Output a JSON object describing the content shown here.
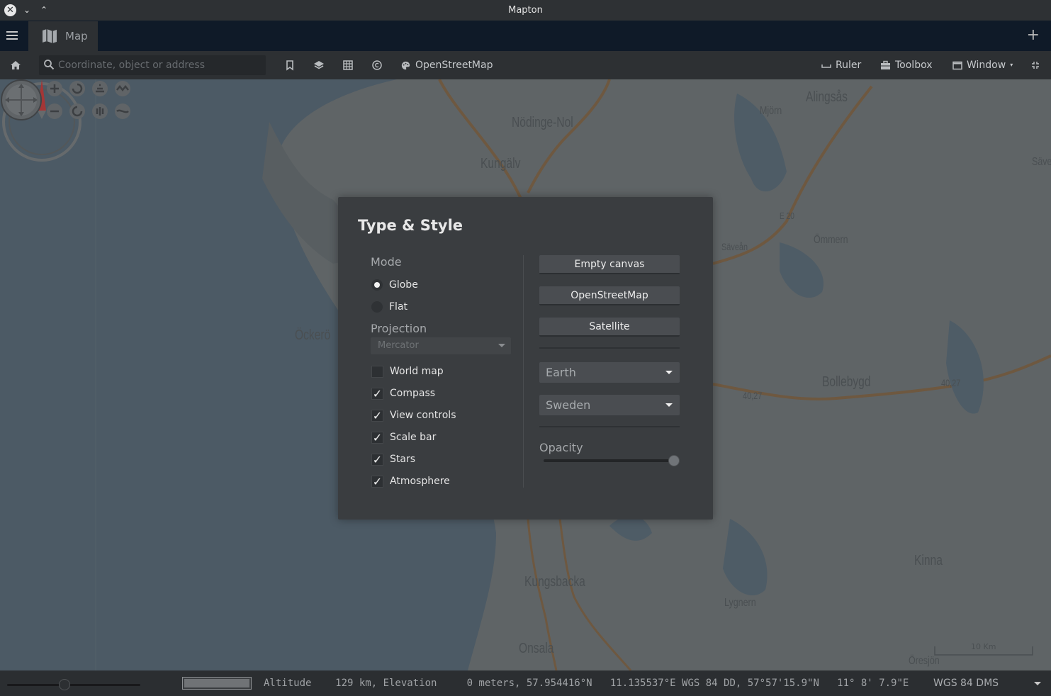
{
  "window": {
    "title": "Mapton"
  },
  "tabs": [
    {
      "label": "Map"
    }
  ],
  "toolbar": {
    "search_placeholder": "Coordinate, object or address",
    "basemap_label": "OpenStreetMap",
    "ruler_label": "Ruler",
    "toolbox_label": "Toolbox",
    "window_label": "Window"
  },
  "map": {
    "labels": {
      "nodinge": "Nödinge-Nol",
      "kungalv": "Kungälv",
      "alingsas": "Alingsås",
      "mjorn": "Mjörn",
      "save": "Säve",
      "ommern": "Ömmern",
      "saveaan": "Säveån",
      "e20": "E 20",
      "ockero": "Öckerö",
      "bollebygd": "Bollebygd",
      "r4027a": "40,27",
      "r4027b": "40,27",
      "kinna": "Kinna",
      "kungsbacka": "Kungsbacka",
      "lygnern": "Lygnern",
      "onsala": "Onsala",
      "oresjon": "Öresjön"
    },
    "scale_label": "10 Km"
  },
  "dialog": {
    "title": "Type & Style",
    "mode_label": "Mode",
    "modes": [
      {
        "label": "Globe",
        "selected": true
      },
      {
        "label": "Flat",
        "selected": false
      }
    ],
    "projection_label": "Projection",
    "projection_value": "Mercator",
    "options": [
      {
        "label": "World map",
        "checked": false
      },
      {
        "label": "Compass",
        "checked": true
      },
      {
        "label": "View controls",
        "checked": true
      },
      {
        "label": "Scale bar",
        "checked": true
      },
      {
        "label": "Stars",
        "checked": true
      },
      {
        "label": "Atmosphere",
        "checked": true
      }
    ],
    "buttons": {
      "empty_canvas": "Empty canvas",
      "openstreetmap": "OpenStreetMap",
      "satellite": "Satellite"
    },
    "planet_value": "Earth",
    "region_value": "Sweden",
    "opacity_label": "Opacity",
    "opacity_value": 1.0
  },
  "status": {
    "altitude_text": "Altitude    129 km, Elevation     0 meters, 57.954416°N   11.135537°E WGS 84 DD, 57°57'15.9\"N   11° 8' 7.9\"E",
    "crs_value": "WGS 84 DMS"
  },
  "colors": {
    "accent_red": "#c23b3b",
    "road": "#b8702e",
    "water": "#4e5c66"
  }
}
